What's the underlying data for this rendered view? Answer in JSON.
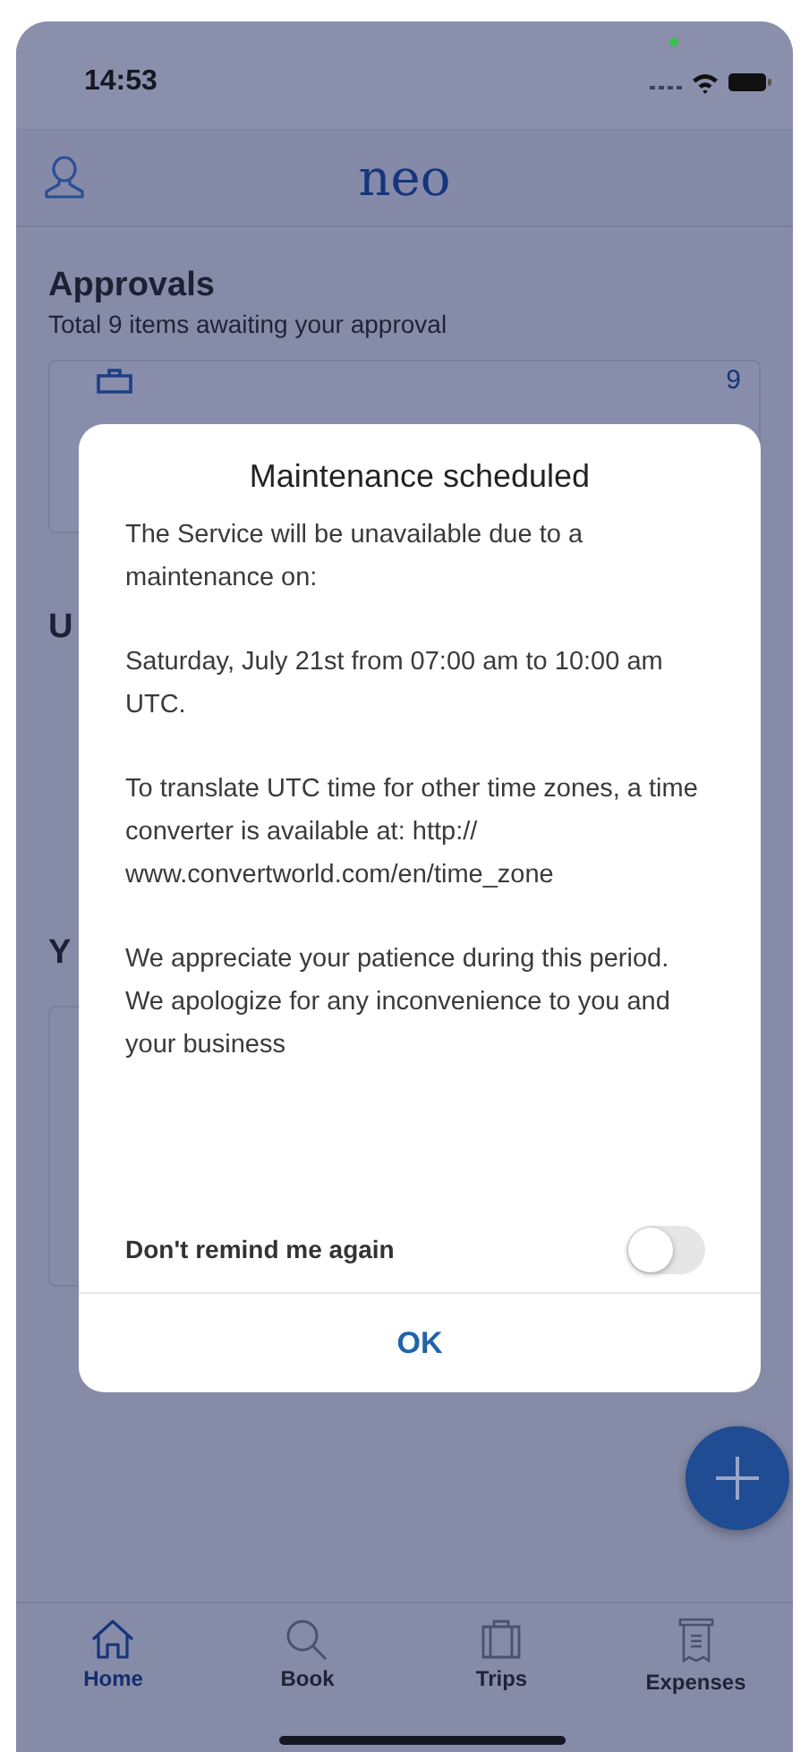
{
  "status_bar": {
    "time": "14:53"
  },
  "header": {
    "logo": "neo"
  },
  "approvals": {
    "title": "Approvals",
    "subtitle": "Total 9 items awaiting your approval",
    "card_count": "9"
  },
  "section_2": {
    "title": "U"
  },
  "section_3": {
    "title": "Y"
  },
  "dialog": {
    "title": "Maintenance scheduled",
    "paragraphs": [
      "The Service will be unavailable due to a maintenance on:",
      "Saturday, July 21st from 07:00 am to 10:00 am UTC.",
      "To translate UTC time for other time zones, a time converter is available at: http:// www.convertworld.com/en/time_zone",
      "We appreciate your patience during this period.\nWe apologize for any inconvenience to you and your business"
    ],
    "toggle": {
      "label": "Don't remind me again",
      "on": false
    },
    "button": "OK"
  },
  "tabs": [
    {
      "label": "Home",
      "kind": "home",
      "selected": true
    },
    {
      "label": "Book",
      "kind": "search",
      "selected": false
    },
    {
      "label": "Trips",
      "kind": "suitcase",
      "selected": false
    },
    {
      "label": "Expenses",
      "kind": "receipt",
      "selected": false
    }
  ]
}
